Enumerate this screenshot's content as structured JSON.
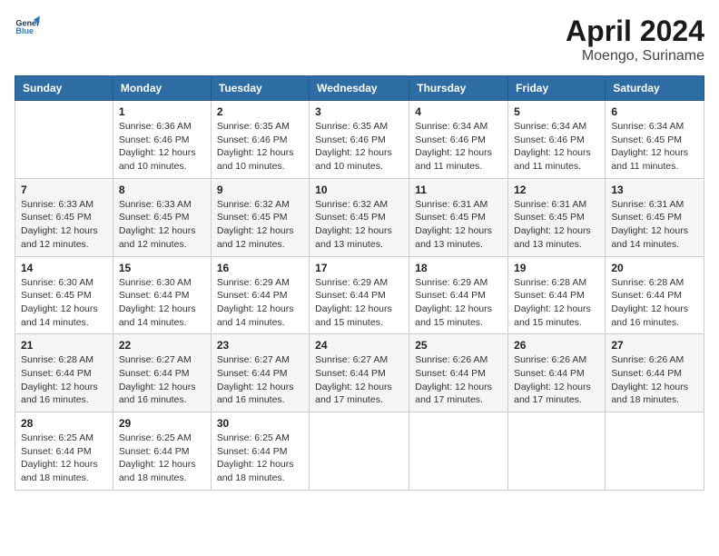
{
  "logo": {
    "line1": "General",
    "line2": "Blue"
  },
  "title": "April 2024",
  "subtitle": "Moengo, Suriname",
  "weekdays": [
    "Sunday",
    "Monday",
    "Tuesday",
    "Wednesday",
    "Thursday",
    "Friday",
    "Saturday"
  ],
  "weeks": [
    [
      {
        "day": "",
        "sunrise": "",
        "sunset": "",
        "daylight": ""
      },
      {
        "day": "1",
        "sunrise": "Sunrise: 6:36 AM",
        "sunset": "Sunset: 6:46 PM",
        "daylight": "Daylight: 12 hours and 10 minutes."
      },
      {
        "day": "2",
        "sunrise": "Sunrise: 6:35 AM",
        "sunset": "Sunset: 6:46 PM",
        "daylight": "Daylight: 12 hours and 10 minutes."
      },
      {
        "day": "3",
        "sunrise": "Sunrise: 6:35 AM",
        "sunset": "Sunset: 6:46 PM",
        "daylight": "Daylight: 12 hours and 10 minutes."
      },
      {
        "day": "4",
        "sunrise": "Sunrise: 6:34 AM",
        "sunset": "Sunset: 6:46 PM",
        "daylight": "Daylight: 12 hours and 11 minutes."
      },
      {
        "day": "5",
        "sunrise": "Sunrise: 6:34 AM",
        "sunset": "Sunset: 6:46 PM",
        "daylight": "Daylight: 12 hours and 11 minutes."
      },
      {
        "day": "6",
        "sunrise": "Sunrise: 6:34 AM",
        "sunset": "Sunset: 6:45 PM",
        "daylight": "Daylight: 12 hours and 11 minutes."
      }
    ],
    [
      {
        "day": "7",
        "sunrise": "Sunrise: 6:33 AM",
        "sunset": "Sunset: 6:45 PM",
        "daylight": "Daylight: 12 hours and 12 minutes."
      },
      {
        "day": "8",
        "sunrise": "Sunrise: 6:33 AM",
        "sunset": "Sunset: 6:45 PM",
        "daylight": "Daylight: 12 hours and 12 minutes."
      },
      {
        "day": "9",
        "sunrise": "Sunrise: 6:32 AM",
        "sunset": "Sunset: 6:45 PM",
        "daylight": "Daylight: 12 hours and 12 minutes."
      },
      {
        "day": "10",
        "sunrise": "Sunrise: 6:32 AM",
        "sunset": "Sunset: 6:45 PM",
        "daylight": "Daylight: 12 hours and 13 minutes."
      },
      {
        "day": "11",
        "sunrise": "Sunrise: 6:31 AM",
        "sunset": "Sunset: 6:45 PM",
        "daylight": "Daylight: 12 hours and 13 minutes."
      },
      {
        "day": "12",
        "sunrise": "Sunrise: 6:31 AM",
        "sunset": "Sunset: 6:45 PM",
        "daylight": "Daylight: 12 hours and 13 minutes."
      },
      {
        "day": "13",
        "sunrise": "Sunrise: 6:31 AM",
        "sunset": "Sunset: 6:45 PM",
        "daylight": "Daylight: 12 hours and 14 minutes."
      }
    ],
    [
      {
        "day": "14",
        "sunrise": "Sunrise: 6:30 AM",
        "sunset": "Sunset: 6:45 PM",
        "daylight": "Daylight: 12 hours and 14 minutes."
      },
      {
        "day": "15",
        "sunrise": "Sunrise: 6:30 AM",
        "sunset": "Sunset: 6:44 PM",
        "daylight": "Daylight: 12 hours and 14 minutes."
      },
      {
        "day": "16",
        "sunrise": "Sunrise: 6:29 AM",
        "sunset": "Sunset: 6:44 PM",
        "daylight": "Daylight: 12 hours and 14 minutes."
      },
      {
        "day": "17",
        "sunrise": "Sunrise: 6:29 AM",
        "sunset": "Sunset: 6:44 PM",
        "daylight": "Daylight: 12 hours and 15 minutes."
      },
      {
        "day": "18",
        "sunrise": "Sunrise: 6:29 AM",
        "sunset": "Sunset: 6:44 PM",
        "daylight": "Daylight: 12 hours and 15 minutes."
      },
      {
        "day": "19",
        "sunrise": "Sunrise: 6:28 AM",
        "sunset": "Sunset: 6:44 PM",
        "daylight": "Daylight: 12 hours and 15 minutes."
      },
      {
        "day": "20",
        "sunrise": "Sunrise: 6:28 AM",
        "sunset": "Sunset: 6:44 PM",
        "daylight": "Daylight: 12 hours and 16 minutes."
      }
    ],
    [
      {
        "day": "21",
        "sunrise": "Sunrise: 6:28 AM",
        "sunset": "Sunset: 6:44 PM",
        "daylight": "Daylight: 12 hours and 16 minutes."
      },
      {
        "day": "22",
        "sunrise": "Sunrise: 6:27 AM",
        "sunset": "Sunset: 6:44 PM",
        "daylight": "Daylight: 12 hours and 16 minutes."
      },
      {
        "day": "23",
        "sunrise": "Sunrise: 6:27 AM",
        "sunset": "Sunset: 6:44 PM",
        "daylight": "Daylight: 12 hours and 16 minutes."
      },
      {
        "day": "24",
        "sunrise": "Sunrise: 6:27 AM",
        "sunset": "Sunset: 6:44 PM",
        "daylight": "Daylight: 12 hours and 17 minutes."
      },
      {
        "day": "25",
        "sunrise": "Sunrise: 6:26 AM",
        "sunset": "Sunset: 6:44 PM",
        "daylight": "Daylight: 12 hours and 17 minutes."
      },
      {
        "day": "26",
        "sunrise": "Sunrise: 6:26 AM",
        "sunset": "Sunset: 6:44 PM",
        "daylight": "Daylight: 12 hours and 17 minutes."
      },
      {
        "day": "27",
        "sunrise": "Sunrise: 6:26 AM",
        "sunset": "Sunset: 6:44 PM",
        "daylight": "Daylight: 12 hours and 18 minutes."
      }
    ],
    [
      {
        "day": "28",
        "sunrise": "Sunrise: 6:25 AM",
        "sunset": "Sunset: 6:44 PM",
        "daylight": "Daylight: 12 hours and 18 minutes."
      },
      {
        "day": "29",
        "sunrise": "Sunrise: 6:25 AM",
        "sunset": "Sunset: 6:44 PM",
        "daylight": "Daylight: 12 hours and 18 minutes."
      },
      {
        "day": "30",
        "sunrise": "Sunrise: 6:25 AM",
        "sunset": "Sunset: 6:44 PM",
        "daylight": "Daylight: 12 hours and 18 minutes."
      },
      {
        "day": "",
        "sunrise": "",
        "sunset": "",
        "daylight": ""
      },
      {
        "day": "",
        "sunrise": "",
        "sunset": "",
        "daylight": ""
      },
      {
        "day": "",
        "sunrise": "",
        "sunset": "",
        "daylight": ""
      },
      {
        "day": "",
        "sunrise": "",
        "sunset": "",
        "daylight": ""
      }
    ]
  ]
}
